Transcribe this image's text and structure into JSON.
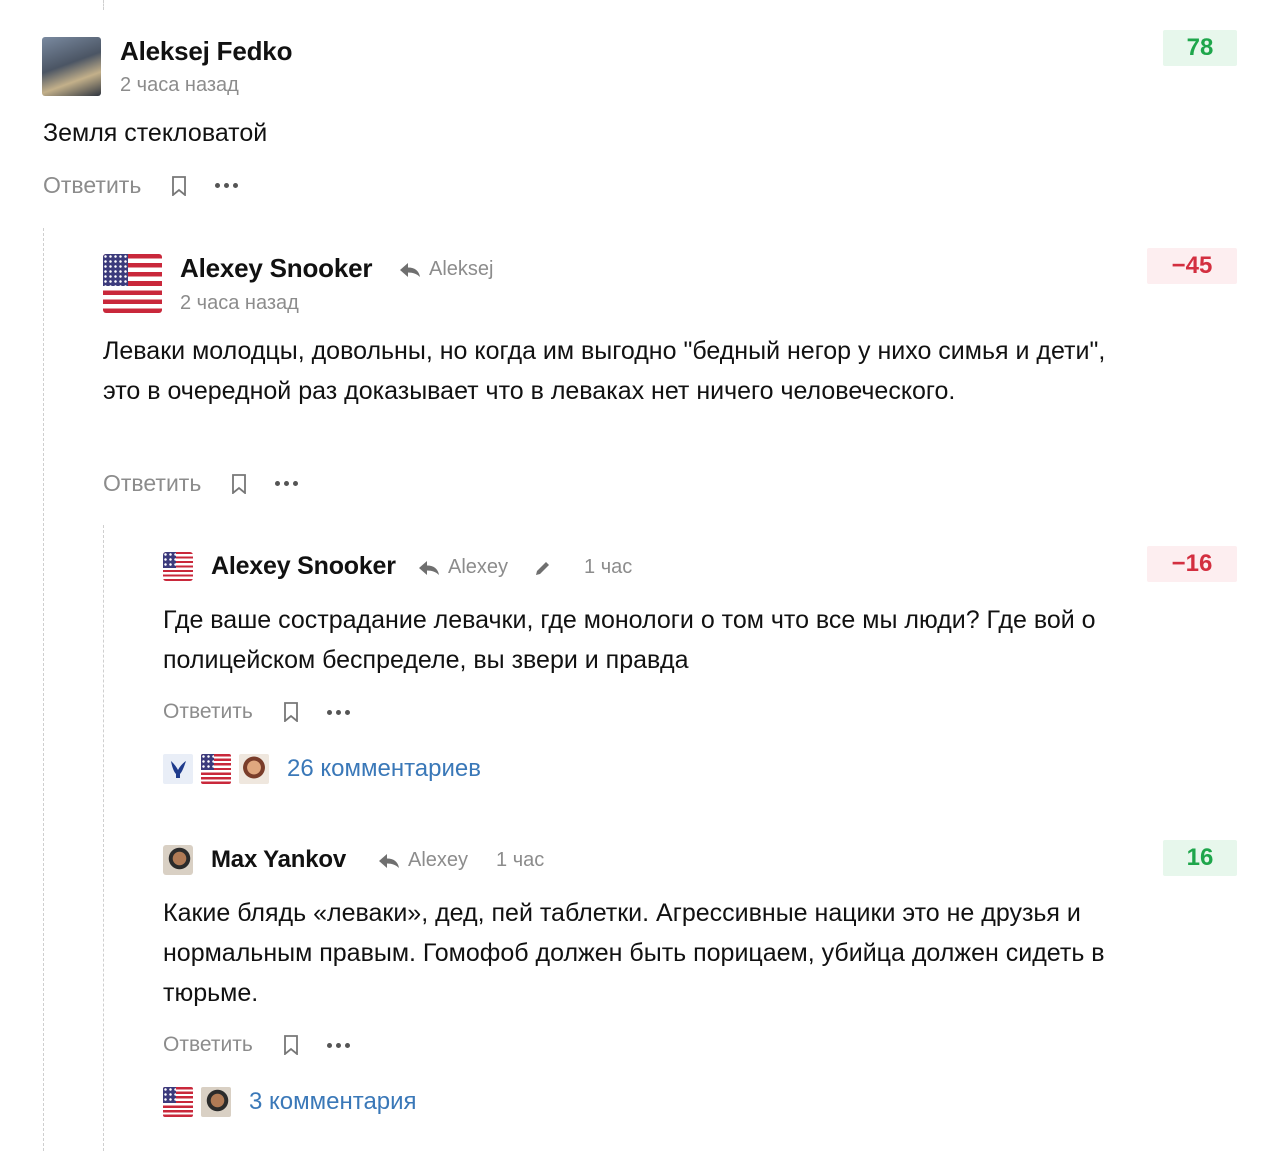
{
  "comments": [
    {
      "author": "Aleksej Fedko",
      "time": "2 часа назад",
      "text": "Земля стекловатой",
      "rating": "78",
      "reply_label": "Ответить"
    },
    {
      "author": "Alexey Snooker",
      "reply_to": "Aleksej",
      "time": "2 часа назад",
      "text": "Леваки молодцы, довольны, но когда им выгодно \"бедный негор у нихо симья и дети\", это в очередной раз доказывает что в леваках нет ничего человеческого.",
      "rating": "−45",
      "reply_label": "Ответить"
    },
    {
      "author": "Alexey Snooker",
      "reply_to": "Alexey",
      "time": "1 час",
      "text": "Где ваше сострадание левачки, где монологи о том что все мы люди? Где вой о полицейском беспределе, вы звери и правда",
      "rating": "−16",
      "reply_label": "Ответить",
      "replies_count": "26 комментариев"
    },
    {
      "author": "Max Yankov",
      "reply_to": "Alexey",
      "time": "1 час",
      "text": "Какие блядь «леваки», дед, пей таблетки. Агрессивные нацики это не друзья и нормальным правым. Гомофоб должен быть порицаем, убийца должен сидеть в тюрьме.",
      "rating": "16",
      "reply_label": "Ответить",
      "replies_count": "3 комментария"
    }
  ],
  "colors": {
    "positive": "#1ea64b",
    "negative": "#d32f40",
    "link": "#3a78b8",
    "muted": "#8c8c8c"
  },
  "icons": [
    "reply-arrow-icon",
    "pencil-icon",
    "bookmark-icon",
    "more-icon"
  ]
}
